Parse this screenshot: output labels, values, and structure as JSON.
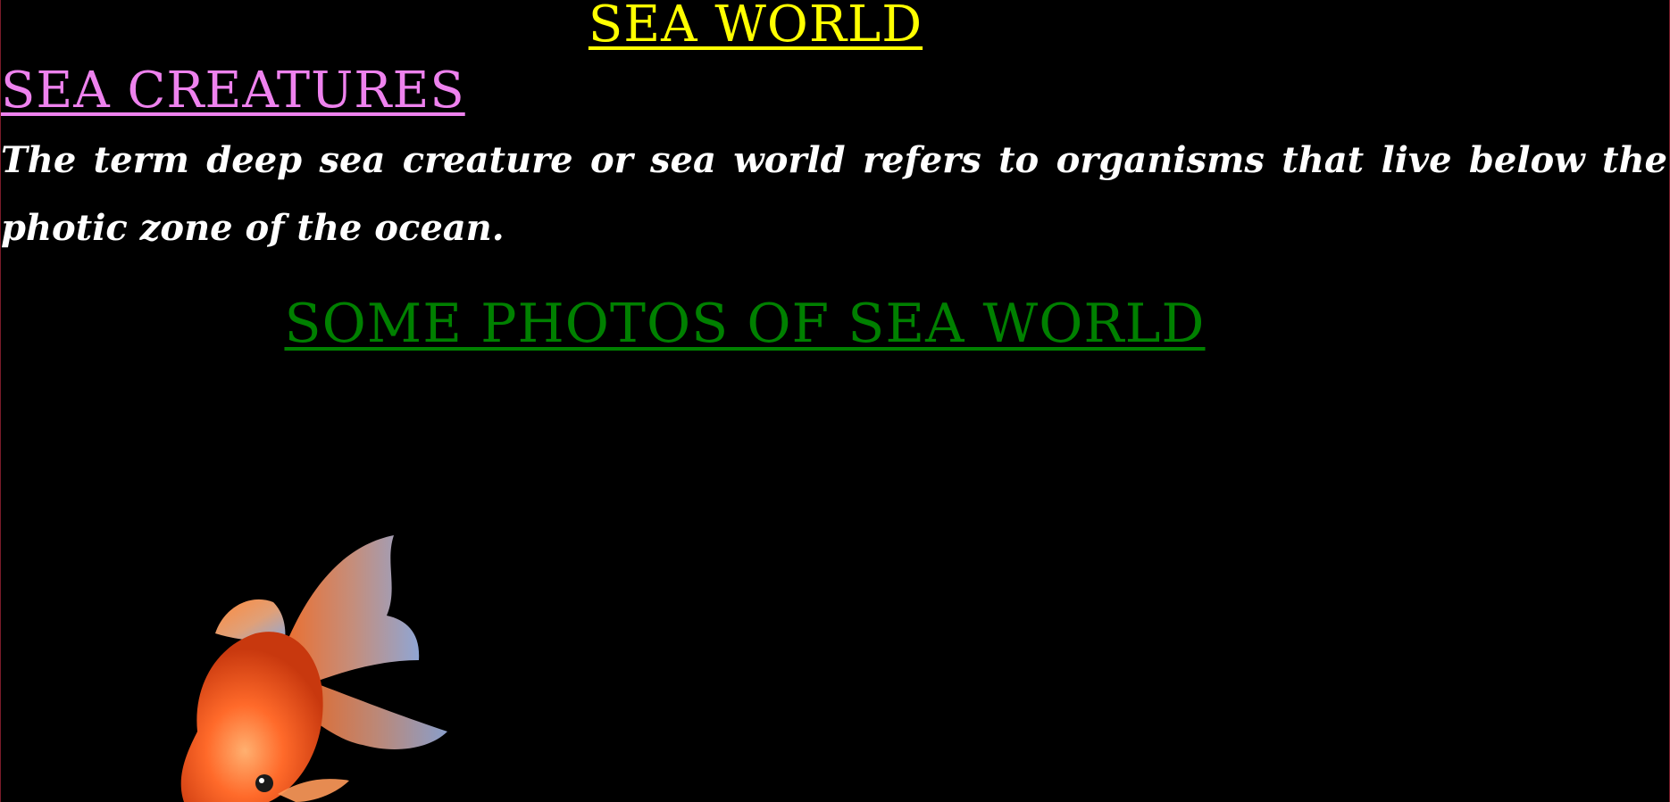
{
  "page": {
    "title": "SEA WORLD",
    "subtitle": "SEA CREATURES",
    "intro": "The term deep sea creature or sea world refers to organisms that live below the photic zone of the ocean.",
    "photos_heading": "SOME PHOTOS OF SEA WORLD"
  },
  "colors": {
    "background": "#000000",
    "title": "#ffff00",
    "subtitle": "#ee82ee",
    "intro": "#ffffff",
    "photos_heading": "#008000"
  },
  "images": {
    "photo": "goldfish-photo"
  }
}
